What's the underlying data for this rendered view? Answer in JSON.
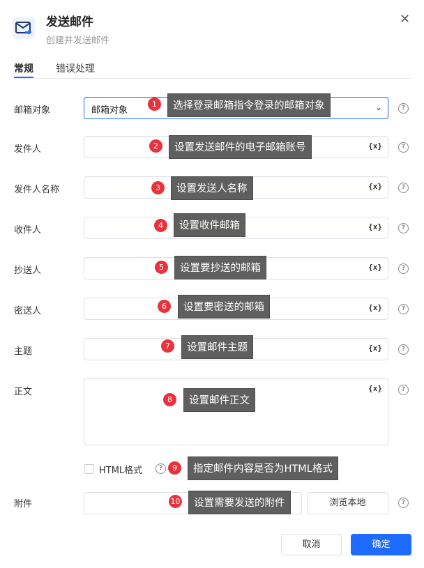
{
  "dialog": {
    "title": "发送邮件",
    "subtitle": "创建并发送邮件",
    "close_glyph": "✕"
  },
  "tabs": [
    {
      "label": "常规",
      "active": true
    },
    {
      "label": "错误处理",
      "active": false
    }
  ],
  "fields": {
    "mailbox": {
      "label": "邮箱对象",
      "value": "邮箱对象"
    },
    "sender": {
      "label": "发件人",
      "value": ""
    },
    "sender_name": {
      "label": "发件人名称",
      "value": ""
    },
    "recipient": {
      "label": "收件人",
      "value": ""
    },
    "cc": {
      "label": "抄送人",
      "value": ""
    },
    "bcc": {
      "label": "密送人",
      "value": ""
    },
    "subject": {
      "label": "主题",
      "value": ""
    },
    "body": {
      "label": "正文",
      "value": ""
    },
    "attachment": {
      "label": "附件",
      "value": ""
    }
  },
  "variable_icon": "{x}",
  "help_glyph": "?",
  "html_format": {
    "label": "HTML格式",
    "checked": false
  },
  "browse_label": "浏览本地",
  "buttons": {
    "cancel": "取消",
    "ok": "确定"
  },
  "annotations": [
    {
      "num": "1",
      "text": "选择登录邮箱指令登录的邮箱对象"
    },
    {
      "num": "2",
      "text": "设置发送邮件的电子邮箱账号"
    },
    {
      "num": "3",
      "text": "设置发送人名称"
    },
    {
      "num": "4",
      "text": "设置收件邮箱"
    },
    {
      "num": "5",
      "text": "设置要抄送的邮箱"
    },
    {
      "num": "6",
      "text": "设置要密送的邮箱"
    },
    {
      "num": "7",
      "text": "设置邮件主题"
    },
    {
      "num": "8",
      "text": "设置邮件正文"
    },
    {
      "num": "9",
      "text": "指定邮件内容是否为HTML格式"
    },
    {
      "num": "10",
      "text": "设置需要发送的附件"
    }
  ],
  "colors": {
    "accent": "#1e6bff",
    "badge": "#e8323c",
    "tooltip": "#5f5f5f"
  }
}
